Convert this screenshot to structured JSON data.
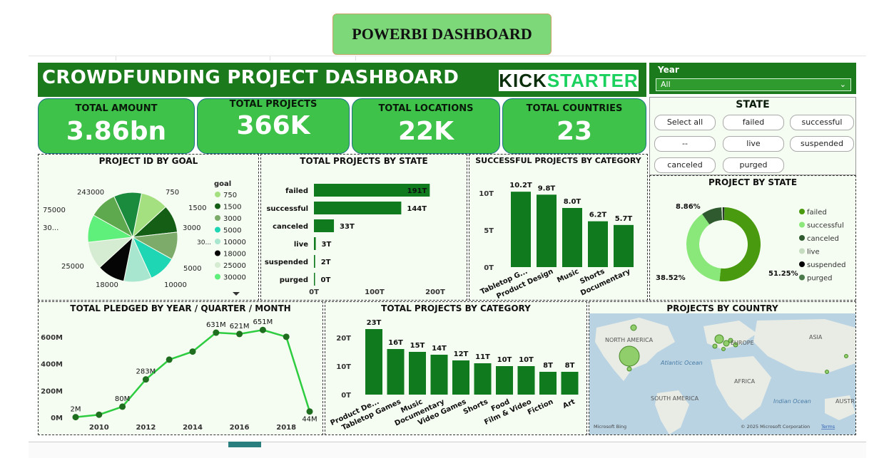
{
  "page_title": "POWERBI DASHBOARD",
  "header": {
    "title": "CROWDFUNDING PROJECT DASHBOARD",
    "logo_part1": "KICK",
    "logo_part2": "STARTER"
  },
  "year_filter": {
    "label": "Year",
    "value": "All"
  },
  "kpis": [
    {
      "label": "TOTAL AMOUNT",
      "value": "3.86bn"
    },
    {
      "label": "TOTAL PROJECTS",
      "value": "366K"
    },
    {
      "label": "TOTAL LOCATIONS",
      "value": "22K"
    },
    {
      "label": "TOTAL COUNTRIES",
      "value": "23"
    }
  ],
  "state_slicer": {
    "title": "STATE",
    "options": [
      "Select all",
      "failed",
      "successful",
      "--",
      "live",
      "suspended",
      "canceled",
      "purged"
    ]
  },
  "colors": {
    "dark_green": "#1b7a1b",
    "bar_green": "#0f7a1e",
    "line_green": "#2ecc40",
    "kpi_green": "#3fc24a",
    "panel_bg": "#f5fcf1"
  },
  "panels": {
    "goal_pie": "PROJECT ID BY GOAL",
    "state_bars": "TOTAL PROJECTS BY STATE",
    "success_cat": "SUCCESSFUL PROJECTS BY CATEGORY",
    "state_donut": "PROJECT BY STATE",
    "pledged_line": "TOTAL PLEDGED BY YEAR / QUARTER / MONTH",
    "cat_bars": "TOTAL PROJECTS BY CATEGORY",
    "country_map": "PROJECTS BY COUNTRY"
  },
  "map": {
    "labels": [
      "NORTH AMERICA",
      "EUROPE",
      "ASIA",
      "Atlantic Ocean",
      "AFRICA",
      "SOUTH AMERICA",
      "Indian Ocean",
      "AUSTR"
    ],
    "footer_left": "Microsoft Bing",
    "footer_right": "© 2025 Microsoft Corporation",
    "terms": "Terms"
  },
  "chart_data": [
    {
      "type": "pie",
      "title": "PROJECT ID BY GOAL",
      "legend_title": "goal",
      "slice_labels": [
        "750",
        "1500",
        "3000",
        "5000",
        "10000",
        "18000",
        "25000",
        "30...",
        "75000",
        "243000"
      ],
      "legend_entries": [
        "750",
        "1500",
        "3000",
        "5000",
        "10000",
        "18000",
        "25000",
        "30000"
      ],
      "inner_label": "30...",
      "values": [
        10,
        10,
        10,
        10,
        10,
        10,
        10,
        10,
        10,
        10
      ],
      "colors": [
        "#a4e07f",
        "#155e15",
        "#7cab6a",
        "#1ed6b4",
        "#a8e6cf",
        "#050505",
        "#d6ecd2",
        "#5ef07a",
        "#5ea84d",
        "#1a8a3c"
      ]
    },
    {
      "type": "bar",
      "orientation": "horizontal",
      "title": "TOTAL PROJECTS BY STATE",
      "categories": [
        "failed",
        "successful",
        "canceled",
        "live",
        "suspended",
        "purged"
      ],
      "values": [
        191,
        144,
        33,
        3,
        2,
        0
      ],
      "labels": [
        "191T",
        "144T",
        "33T",
        "3T",
        "2T",
        "0T"
      ],
      "xticks": [
        "0T",
        "100T",
        "200T"
      ],
      "xlim": [
        0,
        200
      ]
    },
    {
      "type": "bar",
      "title": "SUCCESSFUL PROJECTS BY CATEGORY",
      "categories": [
        "Tabletop G...",
        "Product Design",
        "Music",
        "Shorts",
        "Documentary"
      ],
      "values": [
        10.2,
        9.8,
        8.0,
        6.2,
        5.7
      ],
      "labels": [
        "10.2T",
        "9.8T",
        "8.0T",
        "6.2T",
        "5.7T"
      ],
      "yticks": [
        "0T",
        "5T",
        "10T"
      ],
      "ylim": [
        0,
        10.6
      ]
    },
    {
      "type": "pie",
      "title": "PROJECT BY STATE",
      "categories": [
        "failed",
        "successful",
        "canceled",
        "live",
        "suspended",
        "purged"
      ],
      "values": [
        51.25,
        38.52,
        8.86,
        0.6,
        0.5,
        0.27
      ],
      "visible_labels": [
        "51.25%",
        "38.52%",
        "8.86%"
      ],
      "colors": [
        "#4a9a0f",
        "#8ae87a",
        "#2f5a2f",
        "#c5dcc0",
        "#000000",
        "#4a7a4a"
      ]
    },
    {
      "type": "line",
      "title": "TOTAL PLEDGED BY YEAR / QUARTER / MONTH",
      "x": [
        2009,
        2010,
        2011,
        2012,
        2013,
        2014,
        2015,
        2016,
        2017,
        2018,
        2019
      ],
      "values": [
        2,
        20,
        80,
        283,
        430,
        490,
        631,
        621,
        651,
        600,
        44
      ],
      "point_labels": [
        "2M",
        "",
        "80M",
        "283M",
        "",
        "",
        "631M",
        "621M",
        "651M",
        "",
        "44M"
      ],
      "xticks": [
        "2010",
        "2012",
        "2014",
        "2016",
        "2018"
      ],
      "yticks": [
        "0M",
        "200M",
        "400M",
        "600M"
      ],
      "ylim": [
        0,
        700
      ]
    },
    {
      "type": "bar",
      "title": "TOTAL PROJECTS BY CATEGORY",
      "categories": [
        "Product De...",
        "Tabletop Games",
        "Music",
        "Documentary",
        "Video Games",
        "Shorts",
        "Food",
        "Film & Video",
        "Fiction",
        "Art"
      ],
      "values": [
        23,
        16,
        15,
        14,
        12,
        11,
        10,
        10,
        8,
        8
      ],
      "labels": [
        "23T",
        "16T",
        "15T",
        "14T",
        "12T",
        "11T",
        "10T",
        "10T",
        "8T",
        "8T"
      ],
      "yticks": [
        "0T",
        "10T",
        "20T"
      ],
      "ylim": [
        0,
        25
      ]
    }
  ]
}
